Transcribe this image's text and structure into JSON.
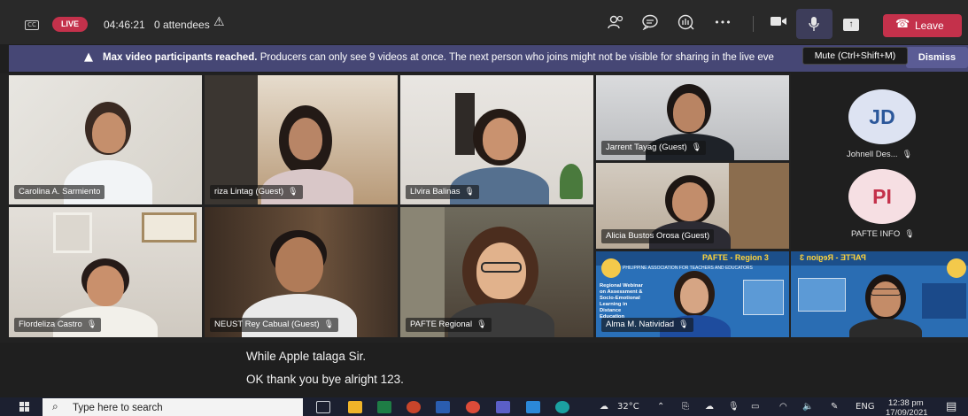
{
  "topbar": {
    "cc_label": "CC",
    "live_label": "LIVE",
    "timer": "04:46:21",
    "attendees": "0 attendees",
    "warning_glyph": "⚠",
    "icons": [
      "people-icon",
      "chat-icon",
      "raise-hand-icon",
      "more-icon",
      "camera-icon",
      "microphone-icon",
      "share-screen-icon"
    ],
    "more_glyph": "•••",
    "leave_label": "Leave",
    "mute_tooltip": "Mute (Ctrl+Shift+M)"
  },
  "notification": {
    "bold_text": "Max video participants reached.",
    "text": "Producers can only see 9 videos at once. The next person who joins might not be visible for sharing in the live eve",
    "dismiss_label": "Dismiss"
  },
  "participants": [
    {
      "name": "Carolina A. Sarmiento",
      "muted": false
    },
    {
      "name": "riza Lintag (Guest)",
      "muted": true
    },
    {
      "name": "Llvira Balinas",
      "muted": true
    },
    {
      "name": "Jarrent Tayag (Guest)",
      "muted": true
    },
    {
      "name": "Flordeliza Castro",
      "muted": true
    },
    {
      "name": "NEUST Rey Cabual (Guest)",
      "muted": true
    },
    {
      "name": "PAFTE Regional",
      "muted": true
    },
    {
      "name": "Alicia Bustos Orosa (Guest)",
      "muted": false
    },
    {
      "name": "Alma M. Natividad",
      "muted": true
    },
    {
      "name": "",
      "muted": false
    }
  ],
  "mute_glyph": "🎙̸",
  "avatars": [
    {
      "initials": "JD",
      "name": "Johnell Des...",
      "bg": "#dde3f2",
      "fg": "#2b579a"
    },
    {
      "initials": "PI",
      "name": "PAFTE INFO",
      "bg": "#f6dfe3",
      "fg": "#c4314b"
    }
  ],
  "shared_screen": {
    "banner": "PAFTE - Region 3",
    "subbanner": "PHILIPPINE ASSOCIATION FOR TEACHERS AND EDUCATORS",
    "lines": [
      "Regional Webinar",
      "on Assessment &",
      "Socio-Emotional",
      "Learning in",
      "Distance",
      "Education"
    ]
  },
  "captions": [
    "While Apple talaga Sir.",
    "OK thank you bye alright 123."
  ],
  "taskbar": {
    "search_placeholder": "Type here to search",
    "weather": "32°C",
    "language": "ENG",
    "time": "12:38 pm",
    "date": "17/09/2021"
  },
  "colors": {
    "live": "#c4314b",
    "leave": "#c4314b",
    "notification": "#464775",
    "accent": "#6264a7"
  }
}
